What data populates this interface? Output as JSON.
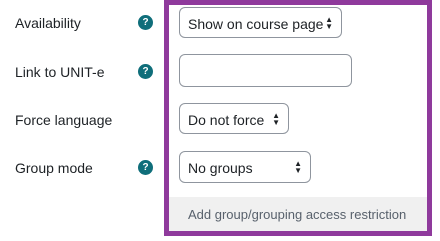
{
  "rows": [
    {
      "label": "Availability",
      "value": "Show on course page"
    },
    {
      "label": "Link to UNIT-e",
      "value": ""
    },
    {
      "label": "Force language",
      "value": "Do not force"
    },
    {
      "label": "Group mode",
      "value": "No groups"
    }
  ],
  "help_glyph": "?",
  "restriction_link": "Add group/grouping access restriction",
  "colors": {
    "help_icon": "#0f6e7a",
    "highlight_border": "#8f3a9c",
    "input_border": "#8f959e",
    "restriction_bar": "#f0f0f0"
  },
  "icons": {
    "help": "help-circle-icon",
    "select_arrows": "sort-arrows-icon"
  }
}
